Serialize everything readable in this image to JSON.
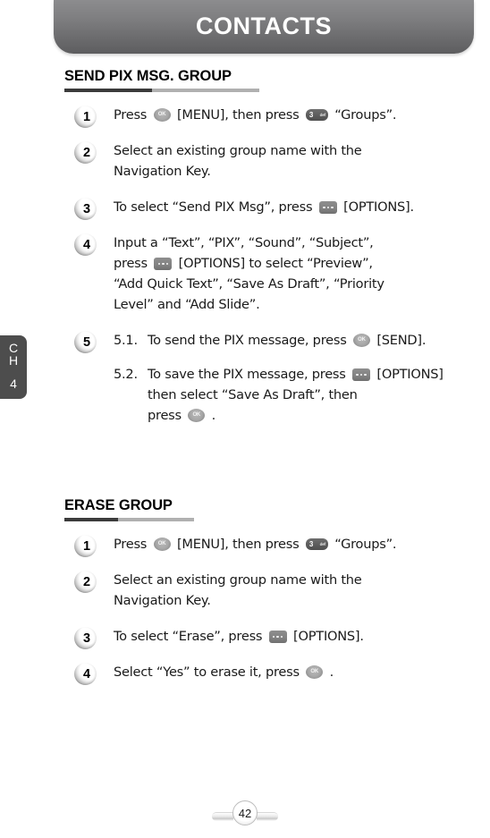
{
  "header": {
    "title": "CONTACTS"
  },
  "chapter_tab": {
    "line1": "C",
    "line2": "H",
    "number": "4"
  },
  "footer": {
    "page_number": "42"
  },
  "icons": {
    "ok_label": "OK",
    "num_digit": "3",
    "num_sub": "def",
    "options_name": "options-icon"
  },
  "colors": {
    "header_gradient_top": "#8c8c8e",
    "header_gradient_bottom": "#5d5d5f",
    "chapter_tab_bg": "#4d4d4d",
    "rule_dark": "#3b3b3b",
    "rule_light": "#b0b0b0",
    "key_dark": "#5c5c5c",
    "key_gray": "#828282",
    "text": "#1a1a1a"
  },
  "sections": [
    {
      "id": "send-pix-msg-group",
      "heading": "SEND PIX MSG. GROUP",
      "steps": [
        {
          "number": "1",
          "lines": [
            [
              {
                "t": "text",
                "v": "Press "
              },
              {
                "t": "key_ok"
              },
              {
                "t": "text",
                "v": " [MENU], then press "
              },
              {
                "t": "key_num"
              },
              {
                "t": "text",
                "v": " “Groups”."
              }
            ]
          ]
        },
        {
          "number": "2",
          "lines": [
            [
              {
                "t": "text",
                "v": "Select an existing group name with the"
              }
            ],
            [
              {
                "t": "text",
                "v": "Navigation Key."
              }
            ]
          ]
        },
        {
          "number": "3",
          "lines": [
            [
              {
                "t": "text",
                "v": "To select “Send PIX Msg”, press "
              },
              {
                "t": "key_options"
              },
              {
                "t": "text",
                "v": " [OPTIONS]."
              }
            ]
          ]
        },
        {
          "number": "4",
          "lines": [
            [
              {
                "t": "text",
                "v": "Input a “Text”, “PIX”, “Sound”, “Subject”,"
              }
            ],
            [
              {
                "t": "text",
                "v": "press "
              },
              {
                "t": "key_options"
              },
              {
                "t": "text",
                "v": " [OPTIONS] to select “Preview”,"
              }
            ],
            [
              {
                "t": "text",
                "v": "“Add Quick Text”, “Save As Draft”, “Priority"
              }
            ],
            [
              {
                "t": "text",
                "v": "Level” and “Add Slide”."
              }
            ]
          ]
        },
        {
          "number": "5",
          "substeps": [
            {
              "label": "5.1.",
              "lines": [
                [
                  {
                    "t": "text",
                    "v": "To send the PIX message, press "
                  },
                  {
                    "t": "key_ok"
                  },
                  {
                    "t": "text",
                    "v": " [SEND]."
                  }
                ]
              ]
            },
            {
              "label": "5.2.",
              "lines": [
                [
                  {
                    "t": "text",
                    "v": "To save the PIX message, press "
                  },
                  {
                    "t": "key_options"
                  },
                  {
                    "t": "text",
                    "v": " [OPTIONS]"
                  }
                ],
                [
                  {
                    "t": "text",
                    "v": "then select “Save As Draft”, then"
                  }
                ],
                [
                  {
                    "t": "text",
                    "v": "press "
                  },
                  {
                    "t": "key_ok"
                  },
                  {
                    "t": "text",
                    "v": " ."
                  }
                ]
              ]
            }
          ]
        }
      ]
    },
    {
      "id": "erase-group",
      "heading": "ERASE GROUP",
      "steps": [
        {
          "number": "1",
          "lines": [
            [
              {
                "t": "text",
                "v": "Press "
              },
              {
                "t": "key_ok"
              },
              {
                "t": "text",
                "v": " [MENU], then press "
              },
              {
                "t": "key_num"
              },
              {
                "t": "text",
                "v": " “Groups”."
              }
            ]
          ]
        },
        {
          "number": "2",
          "lines": [
            [
              {
                "t": "text",
                "v": "Select an existing group name with the"
              }
            ],
            [
              {
                "t": "text",
                "v": "Navigation Key."
              }
            ]
          ]
        },
        {
          "number": "3",
          "lines": [
            [
              {
                "t": "text",
                "v": "To select “Erase”, press "
              },
              {
                "t": "key_options"
              },
              {
                "t": "text",
                "v": " [OPTIONS]."
              }
            ]
          ]
        },
        {
          "number": "4",
          "lines": [
            [
              {
                "t": "text",
                "v": "Select “Yes” to erase it, press "
              },
              {
                "t": "key_ok"
              },
              {
                "t": "text",
                "v": " ."
              }
            ]
          ]
        }
      ]
    }
  ]
}
